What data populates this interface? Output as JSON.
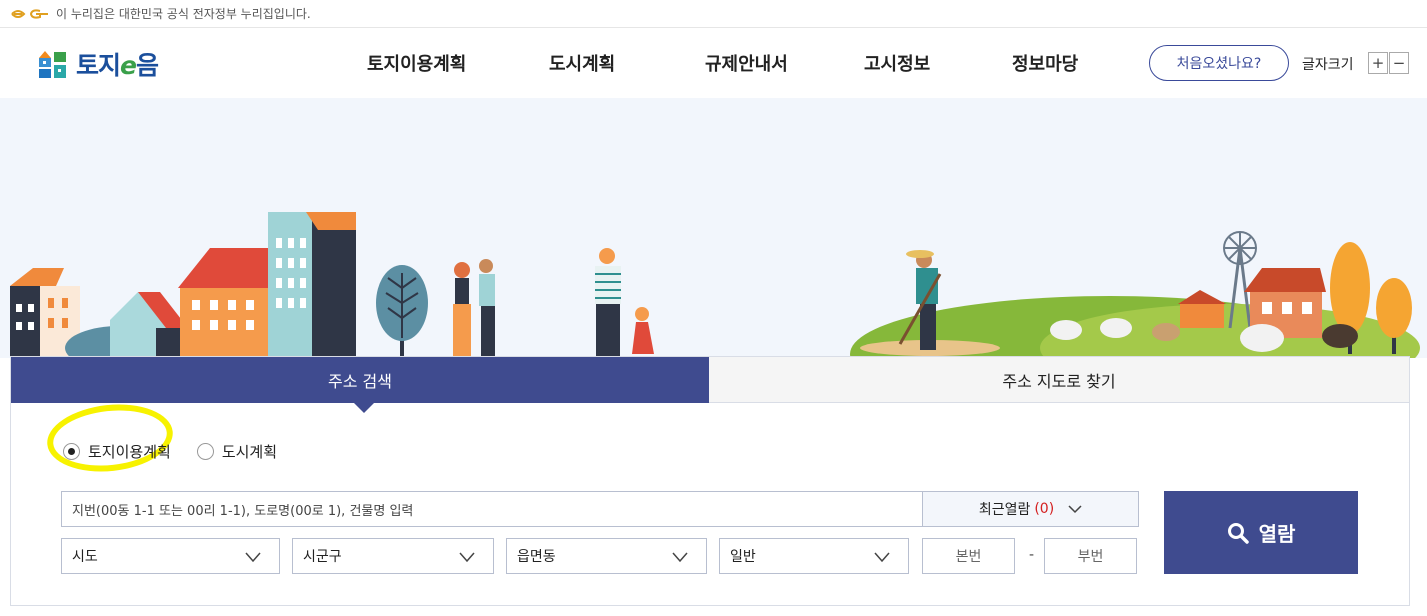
{
  "gov_banner": {
    "text": "이 누리집은 대한민국 공식 전자정부 누리집입니다.",
    "logo_icon": "egov-logo-icon"
  },
  "brand": {
    "name_part1": "토지",
    "name_e": "e",
    "name_part2": "음"
  },
  "nav": {
    "items": [
      {
        "label": "토지이용계획"
      },
      {
        "label": "도시계획"
      },
      {
        "label": "규제안내서"
      },
      {
        "label": "고시정보"
      },
      {
        "label": "정보마당"
      }
    ],
    "first_visit_label": "처음오셨나요?",
    "font_size_label": "글자크기",
    "font_plus": "+",
    "font_minus": "−"
  },
  "tabs": {
    "active_label": "주소 검색",
    "inactive_label": "주소 지도로 찾기"
  },
  "search": {
    "radio_options": [
      {
        "label": "토지이용계획",
        "selected": true
      },
      {
        "label": "도시계획",
        "selected": false
      }
    ],
    "placeholder": "지번(00동 1-1 또는 00리 1-1), 도로명(00로 1), 건물명 입력",
    "recent_label": "최근열람",
    "recent_count": "(0)",
    "selects": [
      {
        "label": "시도"
      },
      {
        "label": "시군구"
      },
      {
        "label": "읍면동"
      },
      {
        "label": "일반"
      }
    ],
    "main_number_placeholder": "본번",
    "dash": "-",
    "sub_number_placeholder": "부번",
    "button_label": "열람"
  },
  "colors": {
    "primary": "#3f4b8f",
    "highlight": "#f7f200",
    "count_red": "#d42020"
  }
}
